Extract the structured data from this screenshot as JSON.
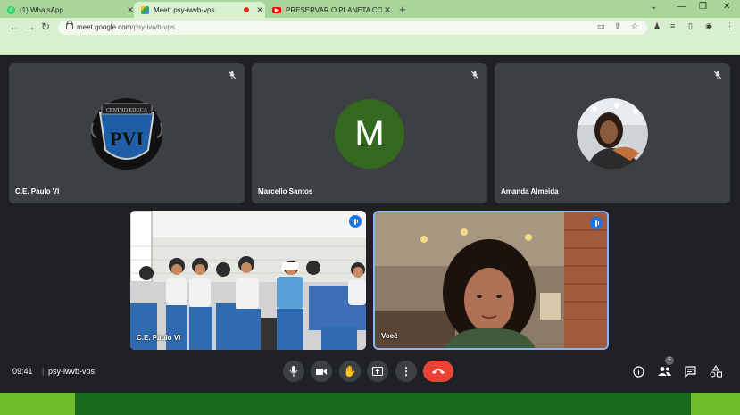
{
  "browser": {
    "tabs": [
      {
        "title": "(1) WhatsApp",
        "icon": "whatsapp-icon",
        "color": "#25d366"
      },
      {
        "title": "Meet: psy-iwvb-vps",
        "icon": "meet-icon",
        "color": "#00897b",
        "active": true
      },
      {
        "title": "PRESERVAR O PLANETA COM O...",
        "icon": "youtube-icon",
        "color": "#ff0000",
        "recording": true
      }
    ],
    "url_host": "meet.google.com",
    "url_path": "/psy-iwvb-vps",
    "theme_color": "#a8d69a"
  },
  "participants": [
    {
      "name": "C.E. Paulo VI",
      "avatar": "school-crest",
      "muted": true
    },
    {
      "name": "Marcello Santos",
      "avatar_letter": "M",
      "avatar_color": "#33691e",
      "muted": true
    },
    {
      "name": "Amanda Almeida",
      "avatar": "photo",
      "muted": true
    }
  ],
  "videos": [
    {
      "name": "C.E. Paulo VI",
      "speaking": true
    },
    {
      "name": "Você",
      "speaking": true,
      "highlighted": true
    }
  ],
  "crest_text": "CENTRO EDUCA",
  "crest_letters": "PVI",
  "meeting": {
    "time": "09:41",
    "code": "psy-iwvb-vps",
    "people_count": "5"
  },
  "colors": {
    "tile_bg": "#3c4043",
    "meet_bg": "#202124",
    "end_call": "#ea4335",
    "highlight": "#8ab4f8"
  }
}
